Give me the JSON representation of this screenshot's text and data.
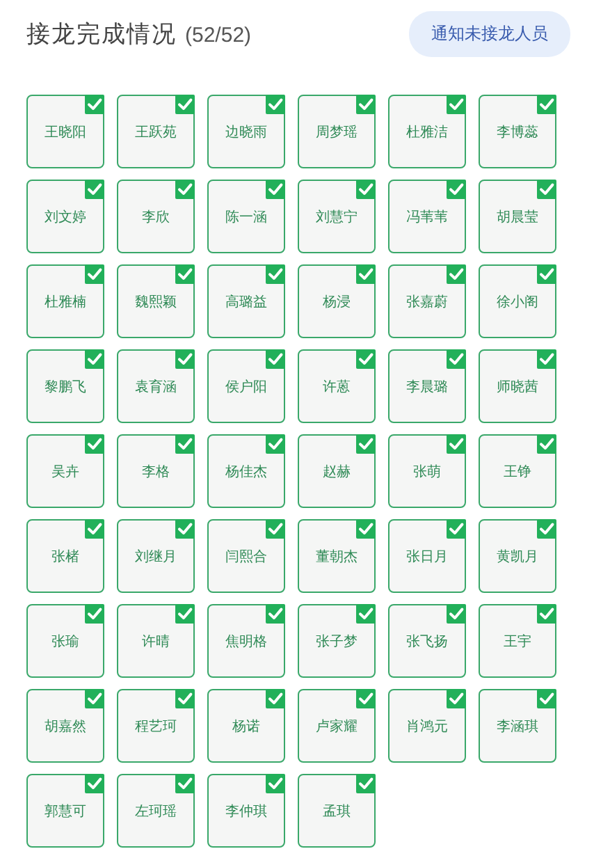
{
  "header": {
    "title": "接龙完成情况",
    "count": "(52/52)",
    "notify_button": "通知未接龙人员"
  },
  "people": [
    {
      "name": "王晓阳",
      "checked": true
    },
    {
      "name": "王跃苑",
      "checked": true
    },
    {
      "name": "边晓雨",
      "checked": true
    },
    {
      "name": "周梦瑶",
      "checked": true
    },
    {
      "name": "杜雅洁",
      "checked": true
    },
    {
      "name": "李博蕊",
      "checked": true
    },
    {
      "name": "刘文婷",
      "checked": true
    },
    {
      "name": "李欣",
      "checked": true
    },
    {
      "name": "陈一涵",
      "checked": true
    },
    {
      "name": "刘慧宁",
      "checked": true
    },
    {
      "name": "冯苇苇",
      "checked": true
    },
    {
      "name": "胡晨莹",
      "checked": true
    },
    {
      "name": "杜雅楠",
      "checked": true
    },
    {
      "name": "魏熙颖",
      "checked": true
    },
    {
      "name": "高璐益",
      "checked": true
    },
    {
      "name": "杨浸",
      "checked": true
    },
    {
      "name": "张嘉蔚",
      "checked": true
    },
    {
      "name": "徐小阁",
      "checked": true
    },
    {
      "name": "黎鹏飞",
      "checked": true
    },
    {
      "name": "袁育涵",
      "checked": true
    },
    {
      "name": "侯户阳",
      "checked": true
    },
    {
      "name": "许蒽",
      "checked": true
    },
    {
      "name": "李晨璐",
      "checked": true
    },
    {
      "name": "师晓茜",
      "checked": true
    },
    {
      "name": "吴卉",
      "checked": true
    },
    {
      "name": "李格",
      "checked": true
    },
    {
      "name": "杨佳杰",
      "checked": true
    },
    {
      "name": "赵赫",
      "checked": true
    },
    {
      "name": "张萌",
      "checked": true
    },
    {
      "name": "王铮",
      "checked": true
    },
    {
      "name": "张楮",
      "checked": true
    },
    {
      "name": "刘继月",
      "checked": true
    },
    {
      "name": "闫熙合",
      "checked": true
    },
    {
      "name": "董朝杰",
      "checked": true
    },
    {
      "name": "张日月",
      "checked": true
    },
    {
      "name": "黄凯月",
      "checked": true
    },
    {
      "name": "张瑜",
      "checked": true
    },
    {
      "name": "许晴",
      "checked": true
    },
    {
      "name": "焦明格",
      "checked": true
    },
    {
      "name": "张子梦",
      "checked": true
    },
    {
      "name": "张飞扬",
      "checked": true
    },
    {
      "name": "王宇",
      "checked": true
    },
    {
      "name": "胡嘉然",
      "checked": true
    },
    {
      "name": "程艺珂",
      "checked": true
    },
    {
      "name": "杨诺",
      "checked": true
    },
    {
      "name": "卢家耀",
      "checked": true
    },
    {
      "name": "肖鸿元",
      "checked": true
    },
    {
      "name": "李涵琪",
      "checked": true
    },
    {
      "name": "郭慧可",
      "checked": true
    },
    {
      "name": "左珂瑶",
      "checked": true
    },
    {
      "name": "李仲琪",
      "checked": true
    },
    {
      "name": "孟琪",
      "checked": true
    }
  ]
}
